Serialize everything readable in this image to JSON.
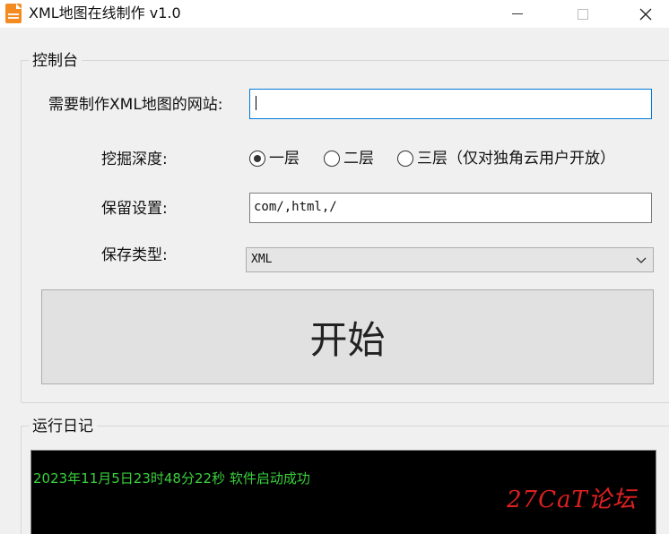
{
  "window": {
    "title": "XML地图在线制作 v1.0",
    "accent": "#f38b20"
  },
  "control_panel": {
    "title": "控制台",
    "url_label": "需要制作XML地图的网站:",
    "url_value": "",
    "depth_label": "挖掘深度:",
    "depth_options": [
      {
        "label": "一层",
        "checked": true
      },
      {
        "label": "二层",
        "checked": false
      },
      {
        "label": "三层（仅对独角云用户开放）",
        "checked": false
      }
    ],
    "keep_label": "保留设置:",
    "keep_value": "com/,html,/",
    "save_type_label": "保存类型:",
    "save_type_value": "XML",
    "start_button": "开始"
  },
  "log_panel": {
    "title": "运行日记",
    "lines": [
      "2023年11月5日23时48分22秒  软件启动成功"
    ],
    "text_color": "#38d13b"
  },
  "watermark": "27CaT论坛"
}
